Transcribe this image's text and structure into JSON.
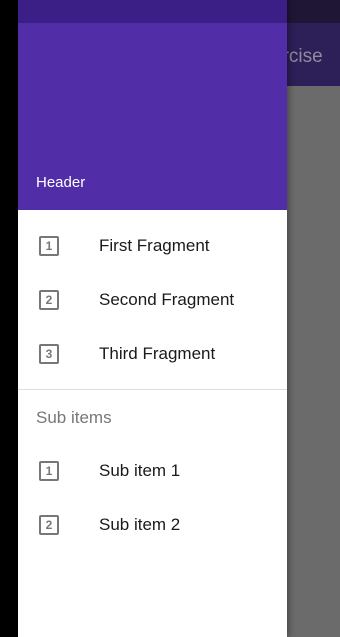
{
  "app": {
    "title_partial": "ercise"
  },
  "drawer": {
    "header_title": "Header",
    "items": [
      {
        "icon": "number-1-icon",
        "num": "1",
        "label": "First Fragment"
      },
      {
        "icon": "number-2-icon",
        "num": "2",
        "label": "Second Fragment"
      },
      {
        "icon": "number-3-icon",
        "num": "3",
        "label": "Third Fragment"
      }
    ],
    "sub_header": "Sub items",
    "sub_items": [
      {
        "icon": "number-1-icon",
        "num": "1",
        "label": "Sub item 1"
      },
      {
        "icon": "number-2-icon",
        "num": "2",
        "label": "Sub item 2"
      }
    ]
  },
  "colors": {
    "primary": "#512da8",
    "primary_dark": "#3b1f86",
    "scrim_content": "#6b6b6b"
  }
}
